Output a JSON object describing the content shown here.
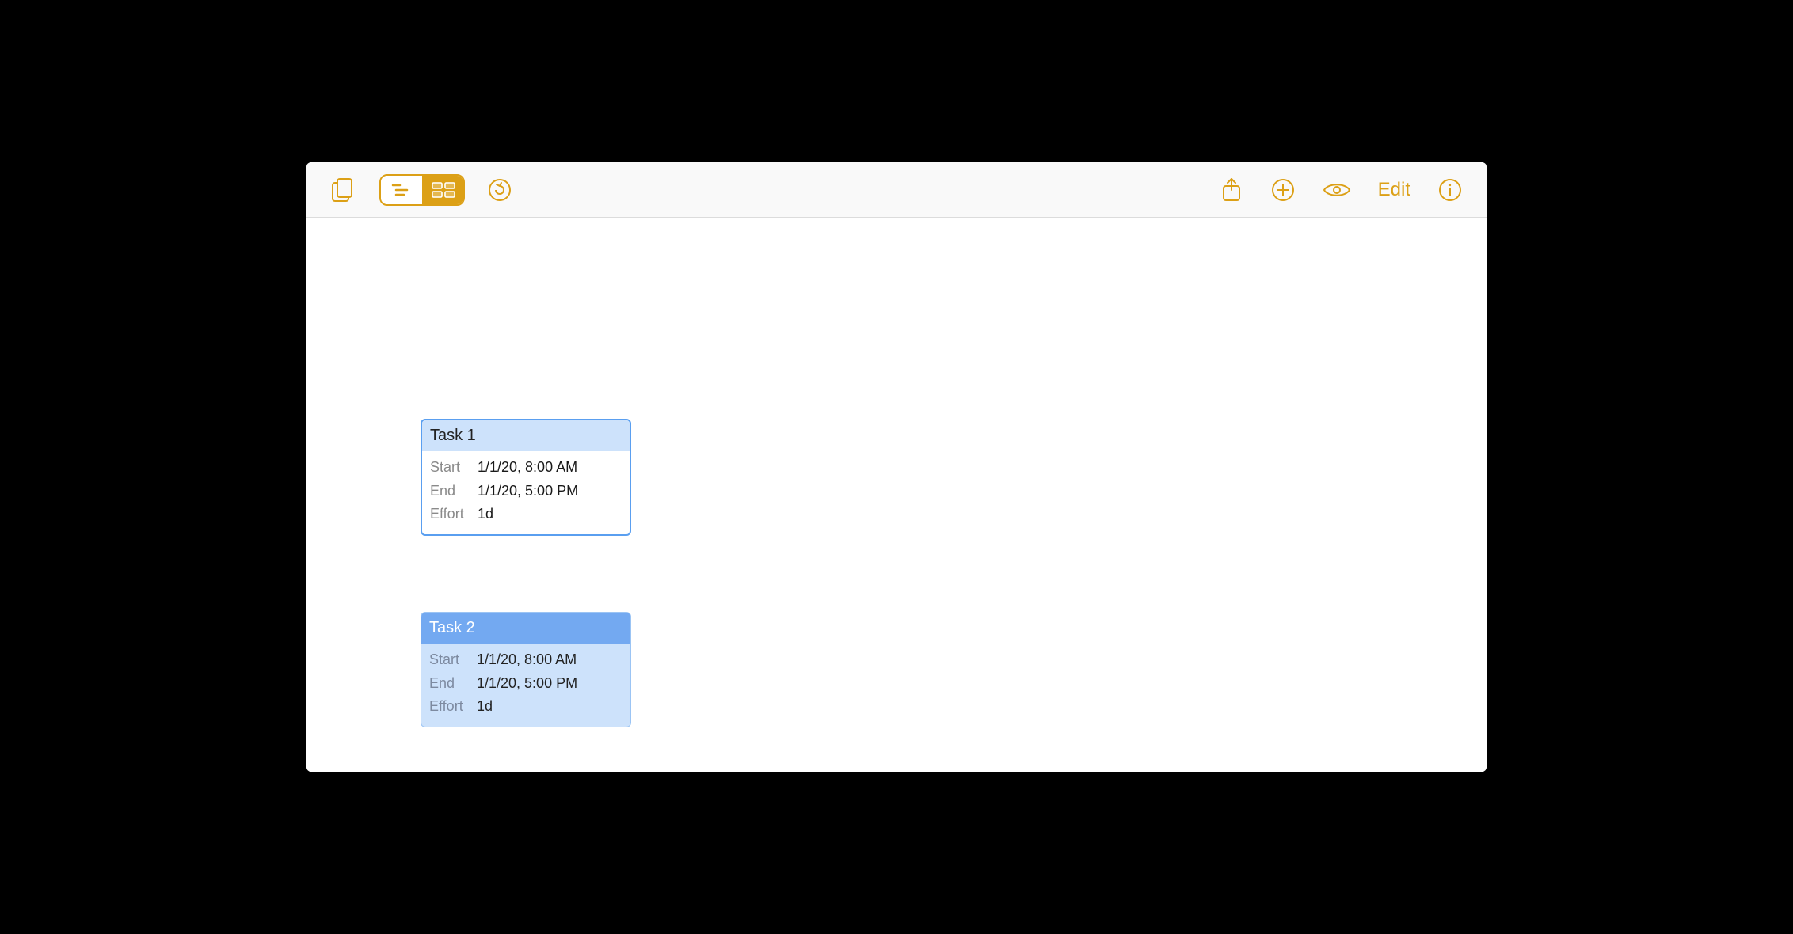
{
  "toolbar": {
    "edit_label": "Edit"
  },
  "field_labels": {
    "start": "Start",
    "end": "End",
    "effort": "Effort"
  },
  "tasks": [
    {
      "title": "Task 1",
      "start": "1/1/20, 8:00 AM",
      "end": "1/1/20, 5:00 PM",
      "effort": "1d",
      "selected": false
    },
    {
      "title": "Task 2",
      "start": "1/1/20, 8:00 AM",
      "end": "1/1/20, 5:00 PM",
      "effort": "1d",
      "selected": true
    }
  ]
}
